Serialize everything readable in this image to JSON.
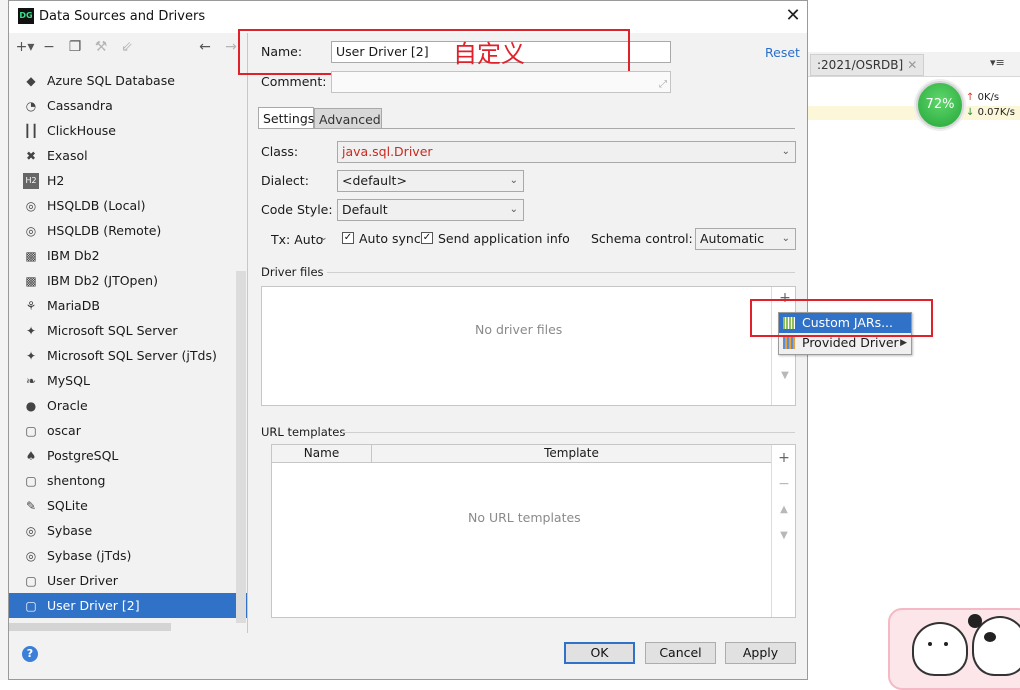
{
  "background_ide": {
    "tab_label": ":2021/OSRDB]",
    "menu_label": "▾≡",
    "gauge_percent": "72%",
    "net_up": "0K/s",
    "net_down": "0.07K/s"
  },
  "window": {
    "title": "Data Sources and Drivers",
    "app_icon_text": "DG"
  },
  "toolbar": {
    "add": "+▾",
    "remove": "−",
    "copy": "❐",
    "settings": "⚒",
    "import": "⇙",
    "back": "←",
    "forward": "→"
  },
  "drivers": [
    {
      "label": "Azure SQL Database",
      "icon": "azure-icon",
      "glyph": "◆"
    },
    {
      "label": "Cassandra",
      "icon": "cassandra-icon",
      "glyph": "◔"
    },
    {
      "label": "ClickHouse",
      "icon": "clickhouse-icon",
      "glyph": "┃┃"
    },
    {
      "label": "Exasol",
      "icon": "exasol-icon",
      "glyph": "✖"
    },
    {
      "label": "H2",
      "icon": "h2-icon",
      "glyph": "H2"
    },
    {
      "label": "HSQLDB (Local)",
      "icon": "hsqldb-icon",
      "glyph": "◎"
    },
    {
      "label": "HSQLDB (Remote)",
      "icon": "hsqldb-icon",
      "glyph": "◎"
    },
    {
      "label": "IBM Db2",
      "icon": "db2-icon",
      "glyph": "▩"
    },
    {
      "label": "IBM Db2 (JTOpen)",
      "icon": "db2-icon",
      "glyph": "▩"
    },
    {
      "label": "MariaDB",
      "icon": "mariadb-icon",
      "glyph": "⚘"
    },
    {
      "label": "Microsoft SQL Server",
      "icon": "sqlserver-icon",
      "glyph": "✦"
    },
    {
      "label": "Microsoft SQL Server (jTds)",
      "icon": "sqlserver-icon",
      "glyph": "✦"
    },
    {
      "label": "MySQL",
      "icon": "mysql-icon",
      "glyph": "❧"
    },
    {
      "label": "Oracle",
      "icon": "oracle-icon",
      "glyph": "●"
    },
    {
      "label": "oscar",
      "icon": "generic-driver-icon",
      "glyph": "▢"
    },
    {
      "label": "PostgreSQL",
      "icon": "postgresql-icon",
      "glyph": "♠"
    },
    {
      "label": "shentong",
      "icon": "generic-driver-icon",
      "glyph": "▢"
    },
    {
      "label": "SQLite",
      "icon": "sqlite-icon",
      "glyph": "✎"
    },
    {
      "label": "Sybase",
      "icon": "sybase-icon",
      "glyph": "◎"
    },
    {
      "label": "Sybase (jTds)",
      "icon": "sybase-icon",
      "glyph": "◎"
    },
    {
      "label": "User Driver",
      "icon": "generic-driver-icon",
      "glyph": "▢"
    },
    {
      "label": "User Driver [2]",
      "icon": "generic-driver-icon",
      "glyph": "▢",
      "selected": true
    }
  ],
  "form": {
    "name_label": "Name:",
    "name_value": "User Driver [2]",
    "annotation": "自定义",
    "comment_label": "Comment:",
    "comment_value": "",
    "reset": "Reset",
    "tabs": [
      "Settings",
      "Advanced"
    ],
    "class_label": "Class:",
    "class_value": "java.sql.Driver",
    "dialect_label": "Dialect:",
    "dialect_value": "<default>",
    "code_style_label": "Code Style:",
    "code_style_value": "Default",
    "tx_label": "Tx: Auto",
    "auto_sync_label": "Auto sync",
    "auto_sync_checked": true,
    "send_app_info_label": "Send application info",
    "send_app_info_checked": true,
    "schema_control_label": "Schema control:",
    "schema_control_value": "Automatic"
  },
  "driver_files": {
    "title": "Driver files",
    "empty": "No driver files",
    "add": "+",
    "remove": "−",
    "up": "▲",
    "down": "▼",
    "menu": [
      {
        "label": "Custom JARs...",
        "highlighted": true
      },
      {
        "label": "Provided Driver",
        "submenu": true
      }
    ]
  },
  "url_templates": {
    "title": "URL templates",
    "columns": [
      "Name",
      "Template"
    ],
    "empty": "No URL templates",
    "add": "+",
    "remove": "−",
    "up": "▲",
    "down": "▼"
  },
  "buttons": {
    "ok": "OK",
    "cancel": "Cancel",
    "apply": "Apply",
    "help": "?"
  },
  "colors": {
    "selection": "#2f72c7",
    "annotation_red": "#e0202a",
    "link": "#2a6fc9",
    "class_red": "#c92a1f"
  }
}
